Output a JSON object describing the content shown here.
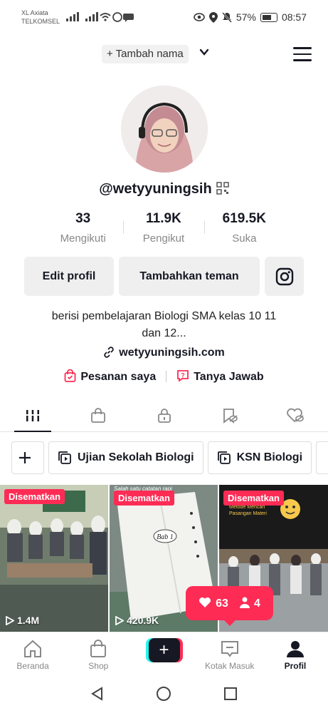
{
  "status_bar": {
    "carrier_1": "XL Axiata",
    "carrier_2": "TELKOMSEL",
    "battery": "57%",
    "time": "08:57"
  },
  "header": {
    "add_name_label": "+ Tambah nama",
    "menu_icon": "hamburger-icon"
  },
  "profile": {
    "username": "@wetyyuningsih",
    "stats": [
      {
        "value": "33",
        "label": "Mengikuti"
      },
      {
        "value": "11.9K",
        "label": "Pengikut"
      },
      {
        "value": "619.5K",
        "label": "Suka"
      }
    ],
    "edit_button": "Edit profil",
    "add_friend_button": "Tambahkan teman",
    "bio_line_1": "berisi pembelajaran Biologi SMA kelas 10 11",
    "bio_line_2": "dan 12...",
    "link": "wetyyuningsih.com",
    "orders": "Pesanan saya",
    "qa": "Tanya Jawab"
  },
  "playlists": [
    "Ujian Sekolah Biologi",
    "KSN Biologi"
  ],
  "videos": [
    {
      "badge": "Disematkan",
      "views": "1.4M"
    },
    {
      "badge": "Disematkan",
      "views": "420.9K",
      "caption": "Salah satu catatan rapi"
    },
    {
      "badge": "Disematkan",
      "views": "",
      "caption_1": "Metode Mencari",
      "caption_2": "Pasangan Materi"
    }
  ],
  "notification": {
    "likes": "63",
    "followers": "4"
  },
  "bottom_nav": {
    "home": "Beranda",
    "shop": "Shop",
    "inbox": "Kotak Masuk",
    "profile": "Profil"
  },
  "colors": {
    "accent": "#fe2c55",
    "cyan": "#25f4ee",
    "text": "#161823"
  }
}
